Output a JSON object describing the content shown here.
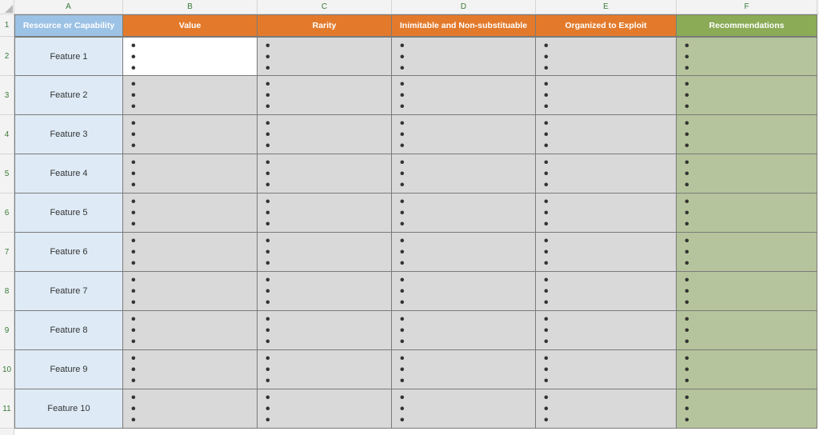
{
  "columns": [
    "A",
    "B",
    "C",
    "D",
    "E",
    "F"
  ],
  "row_numbers": [
    "1",
    "2",
    "3",
    "4",
    "5",
    "6",
    "7",
    "8",
    "9",
    "10",
    "11"
  ],
  "headers": {
    "a": "Resource or Capability",
    "b": "Value",
    "c": "Rarity",
    "d": "Inimitable and Non-substituable",
    "e": "Organized to Exploit",
    "f": "Recommendations"
  },
  "rows": [
    {
      "label": "Feature 1"
    },
    {
      "label": "Feature 2"
    },
    {
      "label": "Feature 3"
    },
    {
      "label": "Feature 4"
    },
    {
      "label": "Feature 5"
    },
    {
      "label": "Feature 6"
    },
    {
      "label": "Feature 7"
    },
    {
      "label": "Feature 8"
    },
    {
      "label": "Feature 9"
    },
    {
      "label": "Feature 10"
    }
  ],
  "bullet_glyph": "•",
  "colors": {
    "hdr_blue": "#9cc2e5",
    "hdr_orange": "#e37a2b",
    "hdr_green": "#8bab56",
    "row_label_bg": "#deebf6",
    "body_gray": "#d9d9d9",
    "body_olive": "#b5c49c"
  }
}
